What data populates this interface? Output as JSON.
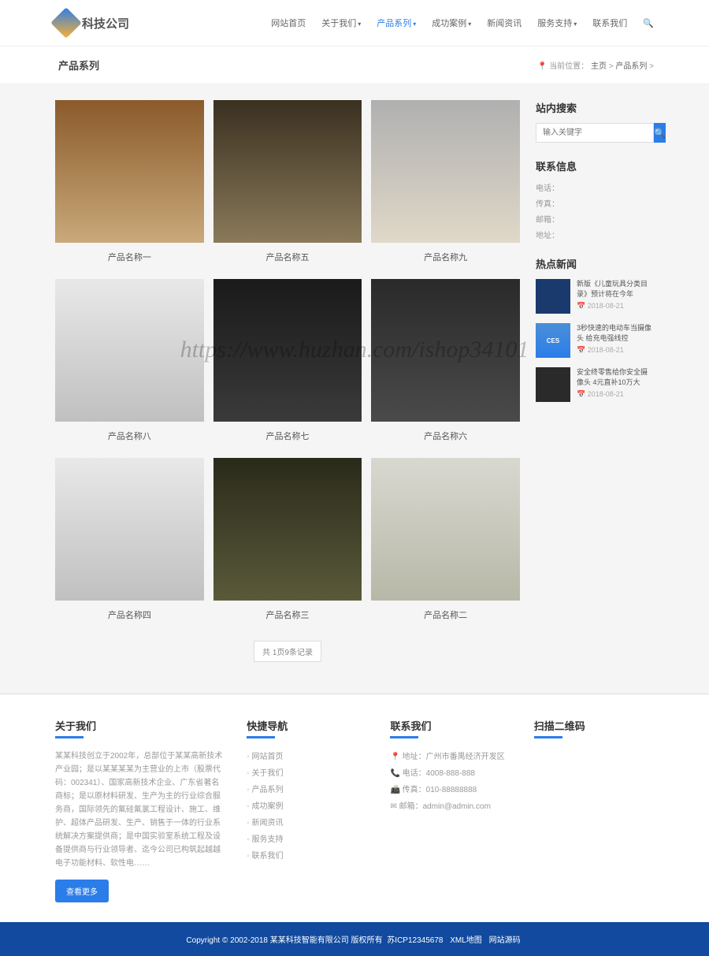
{
  "header": {
    "logo_text": "科技公司",
    "nav": [
      "网站首页",
      "关于我们",
      "产品系列",
      "成功案例",
      "新闻资讯",
      "服务支持",
      "联系我们"
    ],
    "active_index": 2
  },
  "breadcrumb": {
    "title": "产品系列",
    "label": "当前位置：",
    "home": "主页",
    "current": "产品系列"
  },
  "products": [
    {
      "title": "产品名称一",
      "cls": "room1"
    },
    {
      "title": "产品名称五",
      "cls": "room2"
    },
    {
      "title": "产品名称九",
      "cls": "room3"
    },
    {
      "title": "产品名称八",
      "cls": "device1"
    },
    {
      "title": "产品名称七",
      "cls": "device2"
    },
    {
      "title": "产品名称六",
      "cls": "device3"
    },
    {
      "title": "产品名称四",
      "cls": "device1"
    },
    {
      "title": "产品名称三",
      "cls": "room4"
    },
    {
      "title": "产品名称二",
      "cls": "room5"
    }
  ],
  "pagination": "共 1页9条记录",
  "sidebar": {
    "search_title": "站内搜索",
    "search_placeholder": "输入关键字",
    "contact_title": "联系信息",
    "contact": {
      "phone": "电话：",
      "fax": "传真：",
      "email": "邮箱：",
      "address": "地址："
    },
    "hotnews_title": "热点新闻",
    "news": [
      {
        "title": "新版《儿童玩具分类目录》预计将在今年",
        "date": "2018-08-21",
        "cls": ""
      },
      {
        "title": "3秒快速的电动车当摄像头 给充电强线控",
        "date": "2018-08-21",
        "cls": "ces",
        "badge": "CES"
      },
      {
        "title": "安全终零售给你安全摄像头 4元直补10万大",
        "date": "2018-08-21",
        "cls": "dark"
      }
    ]
  },
  "footer": {
    "about": {
      "title": "关于我们",
      "text": "某某科技创立于2002年，总部位于某某高新技术产业园；是以某某某某为主营业的上市（股票代码：002341）、国家高新技术企业、广东省著名商标；是以原材料研发、生产为主的行业综合服务商，国际领先的氟硅氟氯工程设计、施工、维护、超体产品研发、生产、销售于一体的行业系统解决方案提供商；是中国实验室系统工程及设备提供商与行业领导者、迄今公司已构筑起越越电子功能材料、软性电……",
      "more": "查看更多"
    },
    "quicknav": {
      "title": "快捷导航",
      "links": [
        "网站首页",
        "关于我们",
        "产品系列",
        "成功案例",
        "新闻资讯",
        "服务支持",
        "联系我们"
      ]
    },
    "contact": {
      "title": "联系我们",
      "lines": [
        "地址：广州市番禺经济开发区",
        "电话：4008-888-888",
        "传真：010-88888888",
        "邮箱：admin@admin.com"
      ]
    },
    "qr": {
      "title": "扫描二维码"
    }
  },
  "copyright": {
    "text": "Copyright © 2002-2018 某某科技智能有限公司 版权所有",
    "links": [
      "苏ICP12345678",
      "XML地图",
      "网站源码"
    ]
  },
  "watermark": "https://www.huzhan.com/ishop34101"
}
